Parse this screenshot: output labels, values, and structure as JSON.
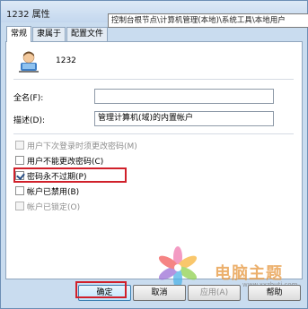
{
  "window": {
    "title": "1232 属性"
  },
  "tooltip": {
    "text": "控制台根节点\\计算机管理(本地)\\系统工具\\本地用户"
  },
  "tabs": [
    {
      "label": "常规",
      "active": true
    },
    {
      "label": "隶属于",
      "active": false
    },
    {
      "label": "配置文件",
      "active": false
    }
  ],
  "general": {
    "username": "1232",
    "fullname_label": "全名(F):",
    "fullname_value": "",
    "description_label": "描述(D):",
    "description_value": "管理计算机(域)的内置帐户",
    "checkboxes": [
      {
        "label": "用户下次登录时须更改密码(M)",
        "checked": false,
        "disabled": true
      },
      {
        "label": "用户不能更改密码(C)",
        "checked": false,
        "disabled": false
      },
      {
        "label": "密码永不过期(P)",
        "checked": true,
        "disabled": false
      },
      {
        "label": "帐户已禁用(B)",
        "checked": false,
        "disabled": false
      },
      {
        "label": "帐户已锁定(O)",
        "checked": false,
        "disabled": true
      }
    ]
  },
  "buttons": {
    "ok": "确定",
    "cancel": "取消",
    "apply": "应用(A)",
    "help": "帮助"
  },
  "watermark": {
    "text": "电脑主题",
    "url": "www.xxzhuti.com"
  },
  "colors": {
    "highlight": "#d0202a",
    "window_bg": "#c9dcef"
  }
}
